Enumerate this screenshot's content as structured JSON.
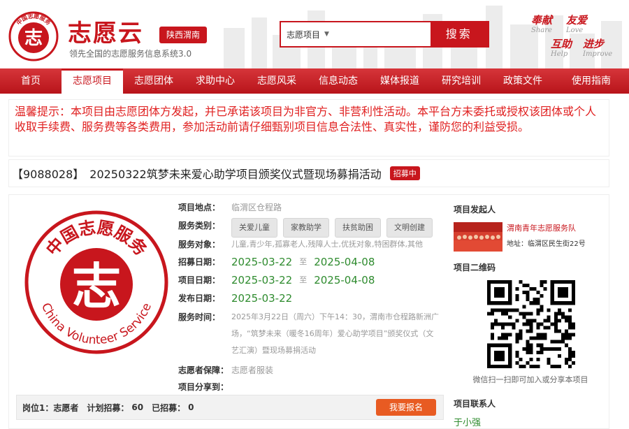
{
  "header": {
    "logo_title": "志愿云",
    "region": "陕西渭南",
    "slogan": "领先全国的志愿服务信息系统3.0",
    "logo_emblem_text": "中国志愿服务",
    "search": {
      "select_value": "志愿项目",
      "button": "搜索"
    },
    "mottos": [
      {
        "cn": "奉献",
        "en": "Share"
      },
      {
        "cn": "友爱",
        "en": "Love"
      },
      {
        "cn": "互助",
        "en": "Help"
      },
      {
        "cn": "进步",
        "en": "Improve"
      }
    ]
  },
  "nav": {
    "items": [
      "首页",
      "志愿项目",
      "志愿团体",
      "求助中心",
      "志愿风采",
      "信息动态",
      "媒体报道",
      "研究培训",
      "政策文件",
      "使用指南"
    ],
    "active": "志愿项目"
  },
  "notice": "温馨提示：本项目由志愿团体方发起，并已承诺该项目为非官方、非营利性活动。本平台方未委托或授权该团体或个人收取手续费、服务费等各类费用，参加活动前请仔细甄别项目信息合法性、真实性，谨防您的利益受损。",
  "project": {
    "id": "【9088028】",
    "title": "20250322筑梦未来爱心助学项目颁奖仪式暨现场募捐活动",
    "status": "招募中",
    "logo_text_cn": "中国志愿服务",
    "logo_text_en": "China Volunteer Service",
    "logo_char": "志",
    "labels": {
      "location": "项目地点：",
      "category": "服务类别：",
      "target": "服务对象：",
      "recruit_date": "招募日期：",
      "project_date": "项目日期：",
      "publish_date": "发布日期：",
      "service_time": "服务时间：",
      "insurance": "志愿者保障：",
      "share": "项目分享到："
    },
    "location": "临渭区仓程路",
    "categories": [
      "关爱儿童",
      "家教助学",
      "扶贫助困",
      "文明创建"
    ],
    "target": "儿童,青少年,孤寡老人,残障人士,优抚对象,特困群体,其他",
    "recruit_start": "2025-03-22",
    "recruit_end": "2025-04-08",
    "project_start": "2025-03-22",
    "project_end": "2025-04-08",
    "to": "至",
    "publish_date": "2025-03-22",
    "service_time": "2025年3月22日（周六）下午14：30，渭南市仓程路新洲广场，“筑梦未来（暖冬16周年）爱心助学项目”颁奖仪式（文艺汇演）暨现场募捐活动",
    "insurance": "志愿者服装"
  },
  "position": {
    "label": "岗位1：志愿者",
    "plan_label": "计划招募：",
    "plan": "60",
    "recruited_label": "已招募：",
    "recruited": "0",
    "button": "我要报名"
  },
  "side": {
    "initiator_heading": "项目发起人",
    "initiator_name": "渭南青年志愿服务队",
    "initiator_address": "地址：临渭区民生街22号",
    "qr_heading": "项目二维码",
    "qr_caption": "微信扫一扫即可加入或分享本项目",
    "contact_heading": "项目联系人",
    "contact_name": "于小强"
  },
  "colors": {
    "brand": "#c8161d",
    "date": "#2e8b2e",
    "join": "#e85b22"
  }
}
